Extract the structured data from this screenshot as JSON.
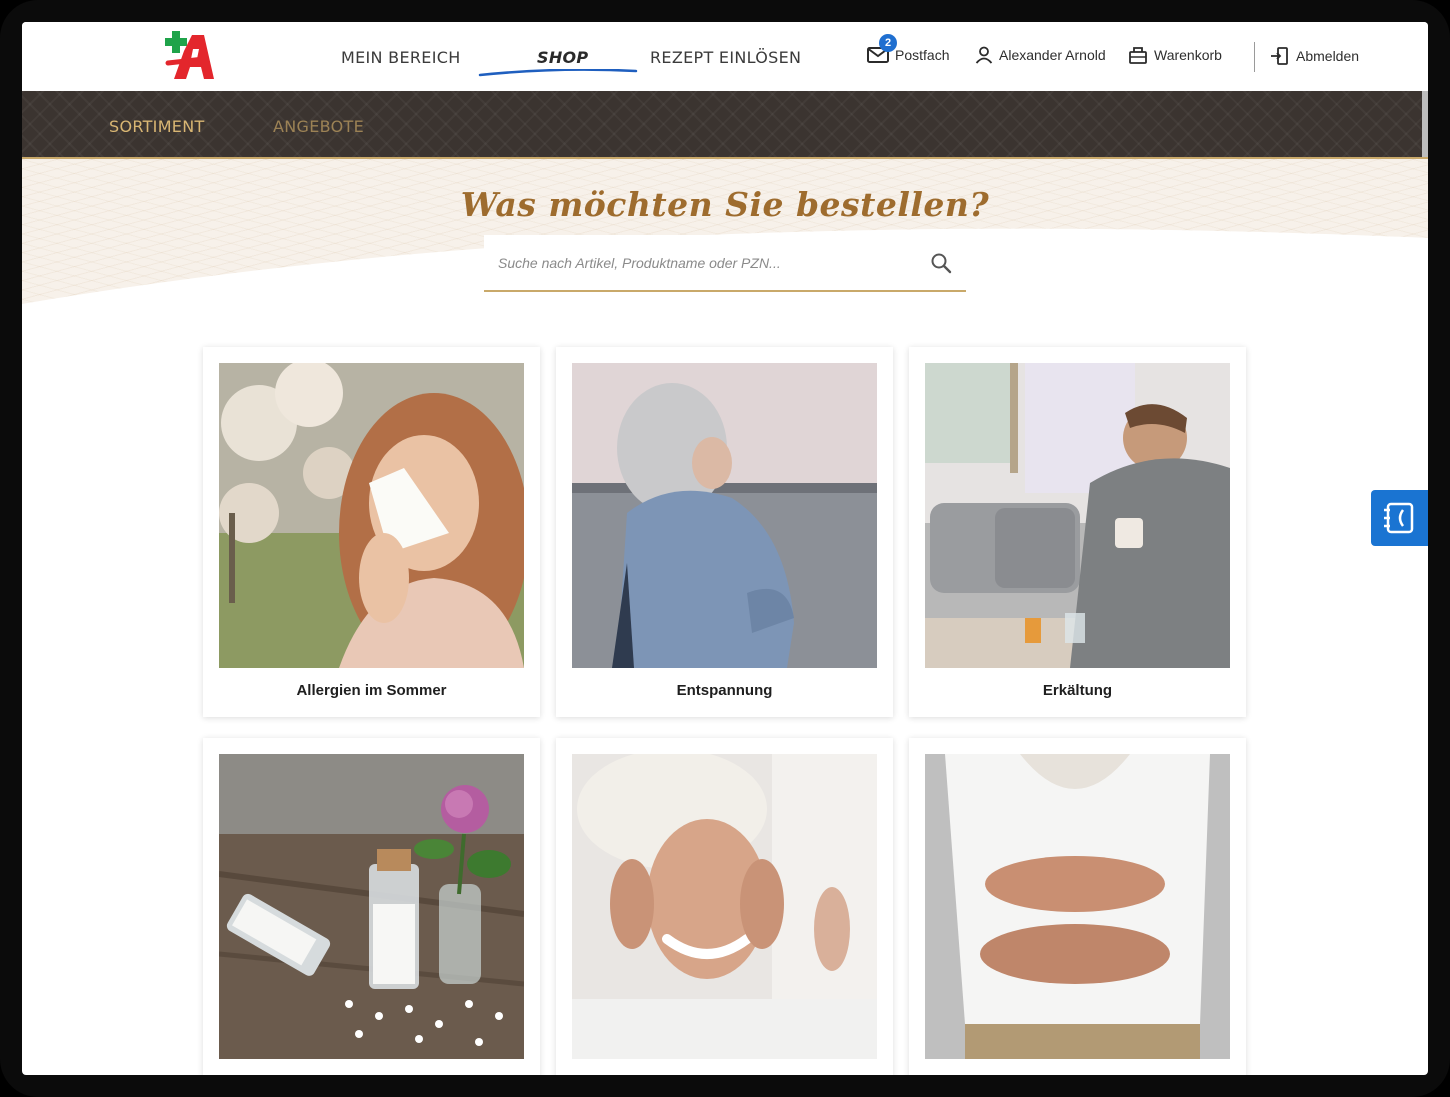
{
  "header": {
    "logo_alt": "A",
    "nav": [
      {
        "label": "MEIN BEREICH"
      },
      {
        "label": "SHOP"
      },
      {
        "label": "REZEPT EINLÖSEN"
      }
    ],
    "mailbox": {
      "label": "Postfach",
      "badge": "2"
    },
    "user": {
      "label": "Alexander Arnold"
    },
    "cart": {
      "label": "Warenkorb"
    },
    "logout": {
      "label": "Abmelden"
    }
  },
  "subnav": {
    "items": [
      {
        "label": "SORTIMENT",
        "active": true
      },
      {
        "label": "ANGEBOTE",
        "active": false
      }
    ]
  },
  "hero": {
    "title": "Was möchten Sie bestellen?",
    "search_placeholder": "Suche nach Artikel, Produktname oder PZN..."
  },
  "categories": [
    {
      "label": "Allergien im Sommer",
      "image": "woman-sneezing-blossoms"
    },
    {
      "label": "Entspannung",
      "image": "elderly-woman-seaside"
    },
    {
      "label": "Erkältung",
      "image": "man-with-blanket-tea"
    },
    {
      "label": "",
      "image": "homeopathic-globules-clover"
    },
    {
      "label": "",
      "image": "woman-skincare-towel"
    },
    {
      "label": "",
      "image": "man-stomach-ache"
    }
  ],
  "colors": {
    "brand_red": "#e3262c",
    "brand_green": "#1fa34a",
    "gold": "#c9a96a",
    "title_brown": "#9e6c2e",
    "subnav_bg": "#3b3430",
    "accent_blue": "#1a74d2"
  },
  "sidetab": {
    "icon": "notebook-icon"
  }
}
